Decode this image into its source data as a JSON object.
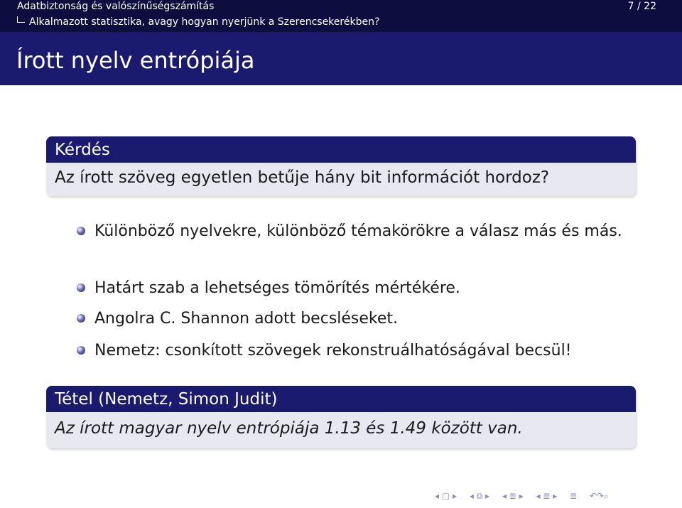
{
  "headline": {
    "section": "Adatbiztonság és valószínűségszámítás",
    "subsection": "Alkalmazott statisztika, avagy hogyan nyerjünk a Szerencsekerékben?",
    "page_counter": "7 / 22"
  },
  "frame_title": "Írott nyelv entrópiája",
  "question_block": {
    "title": "Kérdés",
    "body": "Az írott szöveg egyetlen betűje hány bit információt hordoz?"
  },
  "bullets": [
    {
      "text": "Különböző nyelvekre, különböző témakörökre a válasz más és más."
    },
    {
      "text": "Határt szab a lehetséges tömörítés mértékére."
    },
    {
      "text": "Angolra C. Shannon adott becsléseket."
    },
    {
      "text": "Nemetz: csonkított szövegek rekonstruálhatóságával becsül!"
    }
  ],
  "theorem_block": {
    "title": "Tétel (Nemetz, Simon Judit)",
    "body": "Az írott magyar nyelv entrópiája 1.13 és 1.49 között van."
  },
  "navigation": {
    "icons": [
      "nav-frame-icon",
      "nav-subsection-icon",
      "nav-section-icon",
      "nav-document-icon",
      "nav-appendix-icon",
      "nav-search-icon"
    ],
    "symbols": {
      "frame": "◂ ▢ ▸",
      "subsection": "◂ ⧉ ▸",
      "section": "◂ ≣ ▸",
      "document": "◂ ≣ ▸",
      "appendix": "≣",
      "search": "↶↷⌕"
    }
  },
  "colors": {
    "header_dark": "#0d0d3f",
    "header_title": "#1a1a6e",
    "block_body": "#e8e8f1",
    "nav": "#8b8bc0"
  }
}
